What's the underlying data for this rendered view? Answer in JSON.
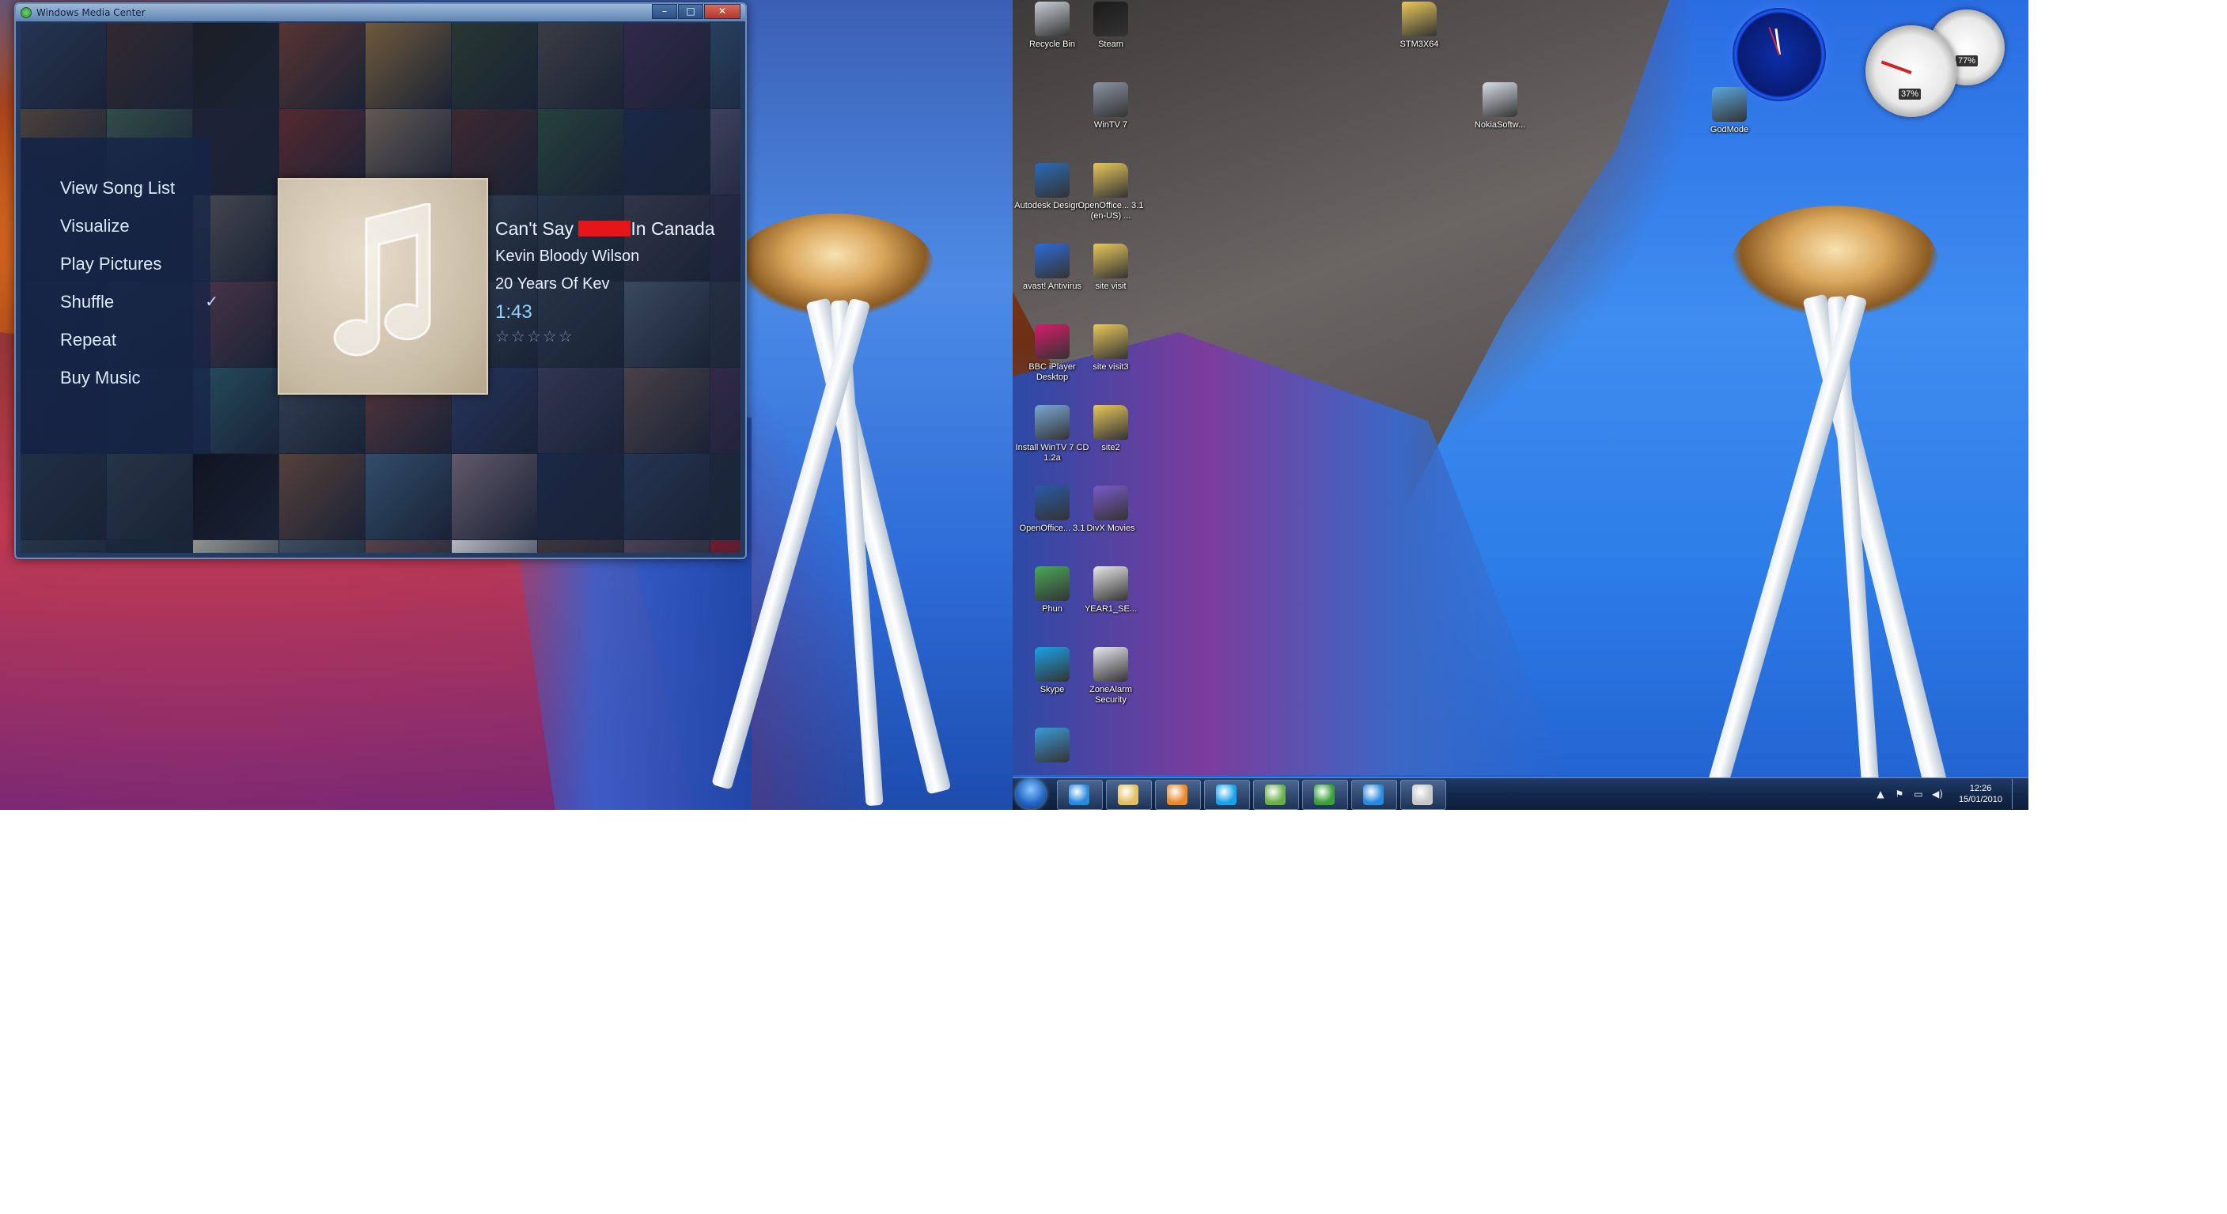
{
  "wmc": {
    "title": "Windows Media Center",
    "controls": {
      "minimize": "–",
      "maximize": "□",
      "close": "✕"
    },
    "menu": [
      {
        "label": "View Song List",
        "checked": false
      },
      {
        "label": "Visualize",
        "checked": false
      },
      {
        "label": "Play Pictures",
        "checked": false
      },
      {
        "label": "Shuffle",
        "checked": true
      },
      {
        "label": "Repeat",
        "checked": false
      },
      {
        "label": "Buy Music",
        "checked": false
      }
    ],
    "check_glyph": "✓",
    "now_playing": {
      "title_before": "Can't Say ",
      "title_after": "In Canada",
      "artist": "Kevin Bloody Wilson",
      "album": "20 Years Of Kev",
      "time": "1:43",
      "stars": "☆☆☆☆☆",
      "rating": 0
    },
    "tile_colors": [
      "#2a3a5a",
      "#3c2b2b",
      "#1c1c1c",
      "#6d3a2e",
      "#8c6b3a",
      "#2d3d2d",
      "#454545",
      "#3b2a50",
      "#2c4a6a",
      "#5a4a3a",
      "#3a5a4a",
      "#222233",
      "#6a2a2a",
      "#7a6a5a",
      "#4a2a2a",
      "#2a4a3a",
      "#1a2a4a",
      "#4a4a6a",
      "#333344",
      "#2a2a3a",
      "#555555",
      "#203040",
      "#4a3a2a",
      "#3a4a5a",
      "#2a3a4a",
      "#3a3a4a",
      "#2a2a44",
      "#2a3344",
      "#3a4455",
      "#5a3a4a",
      "#2a4055",
      "#224466",
      "#334455",
      "#2a3a4a",
      "#445566",
      "#2a3344",
      "#3a2a3a",
      "#2a3a4a",
      "#2a5a6a",
      "#3a4a5a",
      "#6a3a3a",
      "#2a3a6a",
      "#3a3a5a",
      "#5a4a4a",
      "#3a2a4a",
      "#223344",
      "#2a3a4a",
      "#0e0e18",
      "#6a4a3a",
      "#3a5a7a",
      "#7a6a7a",
      "#1a2a4a",
      "#2a3a5a",
      "#1a2a3a",
      "#2a3a4a",
      "#1a2a3a",
      "#b8b8a8",
      "#4a5a6a",
      "#6a4a4a",
      "#e8e8e8",
      "#4a3a3a",
      "#5a4a5a",
      "#8a1a2a"
    ],
    "accent_text": "#dde9ff",
    "time_color": "#8fd3ff"
  },
  "desktop": {
    "icons": [
      {
        "label": "Recycle Bin",
        "icon": "recycle-bin-icon",
        "color": "#c9ced6"
      },
      {
        "label": "Steam",
        "icon": "steam-icon",
        "color": "#1b1b1b"
      },
      {
        "label": "WinTV 7",
        "icon": "wintv-icon",
        "color": "#8a93a3"
      },
      {
        "label": "Autodesk Design ...",
        "icon": "autodesk-icon",
        "color": "#2a6bb8"
      },
      {
        "label": "OpenOffice... 3.1 (en-US) ...",
        "icon": "folder-icon",
        "color": "#e8c85a"
      },
      {
        "label": "avast! Antivirus",
        "icon": "avast-icon",
        "color": "#2f6bd6"
      },
      {
        "label": "site visit",
        "icon": "folder-icon",
        "color": "#e8c85a"
      },
      {
        "label": "BBC iPlayer Desktop",
        "icon": "bbc-iplayer-icon",
        "color": "#d81b6a"
      },
      {
        "label": "site visit3",
        "icon": "folder-icon",
        "color": "#e8c85a"
      },
      {
        "label": "Install WinTV 7 CD 1.2a",
        "icon": "installer-icon",
        "color": "#7aa8d8"
      },
      {
        "label": "site2",
        "icon": "folder-icon",
        "color": "#e8c85a"
      },
      {
        "label": "OpenOffice... 3.1",
        "icon": "openoffice-icon",
        "color": "#2a5aa8"
      },
      {
        "label": "DivX Movies",
        "icon": "divx-icon",
        "color": "#7a5ac8"
      },
      {
        "label": "Phun",
        "icon": "phun-icon",
        "color": "#4aa85a"
      },
      {
        "label": "YEAR1_SE...",
        "icon": "pdf-icon",
        "color": "#e8e8e8"
      },
      {
        "label": "Skype",
        "icon": "skype-icon",
        "color": "#1aa3e8"
      },
      {
        "label": "ZoneAlarm Security",
        "icon": "zonealarm-icon",
        "color": "#e8e8f0"
      },
      {
        "label": "",
        "icon": "figure-icon",
        "color": "#3a9ad8"
      },
      {
        "label": "STM3X64",
        "icon": "folder-icon",
        "color": "#e8c85a"
      },
      {
        "label": "NokiaSoftw...",
        "icon": "nokia-installer-icon",
        "color": "#d8dfe8"
      },
      {
        "label": "GodMode",
        "icon": "control-panel-icon",
        "color": "#5aa8e0"
      }
    ],
    "gadgets": {
      "cpu_percent": "37%",
      "ram_percent": "77%"
    }
  },
  "taskbar": {
    "buttons": [
      {
        "name": "internet-explorer",
        "color": "#2a8ae0"
      },
      {
        "name": "windows-explorer",
        "color": "#e0c060"
      },
      {
        "name": "media-player",
        "color": "#e88a2a"
      },
      {
        "name": "skype",
        "color": "#1aa3e8"
      },
      {
        "name": "network-app",
        "color": "#6ab04a"
      },
      {
        "name": "media-center",
        "color": "#3aa03a"
      },
      {
        "name": "internet-explorer-2",
        "color": "#2a8ae0"
      },
      {
        "name": "chrome",
        "color": "#c8c8c8"
      }
    ],
    "tray": {
      "chevron": "▲",
      "flag": "⚑",
      "network": "▭",
      "volume": "◀)",
      "time": "12:26",
      "date": "15/01/2010"
    }
  }
}
